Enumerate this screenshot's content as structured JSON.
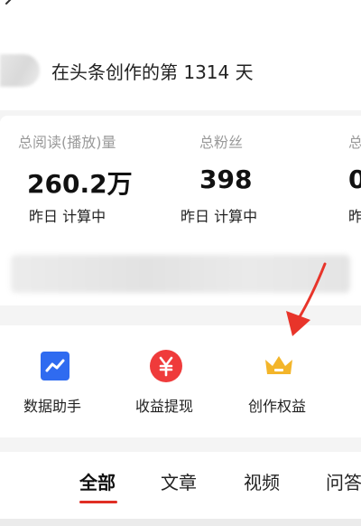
{
  "header": {
    "days_text": "在头条创作的第 1314 天"
  },
  "stats": [
    {
      "label": "总阅读(播放)量",
      "value": "260.2万",
      "sub": "昨日 计算中"
    },
    {
      "label": "总粉丝",
      "value": "398",
      "sub": "昨日 计算中"
    },
    {
      "label": "总",
      "value": "0",
      "sub": "昨"
    }
  ],
  "tools": [
    {
      "label": "数据助手",
      "icon": "chart-icon",
      "color": "#2f6bf0"
    },
    {
      "label": "收益提现",
      "icon": "yen-icon",
      "color": "#ef3b3b"
    },
    {
      "label": "创作权益",
      "icon": "crown-icon",
      "color": "#f3b52a"
    }
  ],
  "tabs": [
    {
      "label": "全部",
      "active": true
    },
    {
      "label": "文章"
    },
    {
      "label": "视频"
    },
    {
      "label": "问答"
    }
  ],
  "colors": {
    "accent": "#e02e24",
    "annotation_arrow": "#e8342a"
  }
}
